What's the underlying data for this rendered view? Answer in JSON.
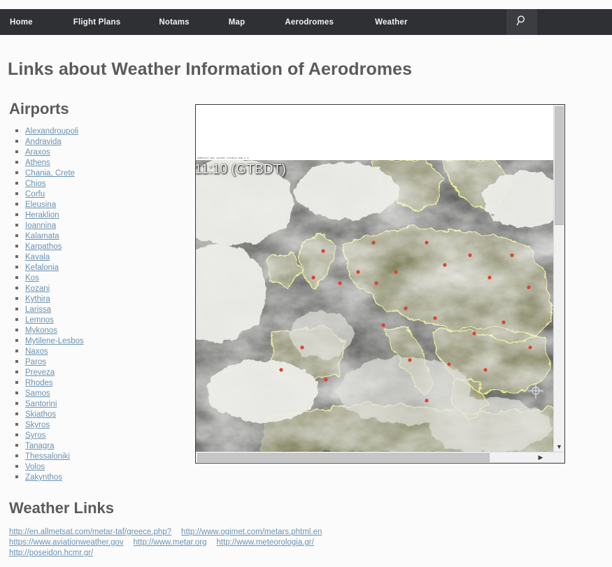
{
  "nav": {
    "items": [
      {
        "id": "home",
        "label": "Home"
      },
      {
        "id": "flight",
        "label": "Flight Plans"
      },
      {
        "id": "notams",
        "label": "Notams"
      },
      {
        "id": "map",
        "label": "Map"
      },
      {
        "id": "aerodromes",
        "label": "Aerodromes"
      },
      {
        "id": "weather",
        "label": "Weather"
      }
    ],
    "search_icon": "search-icon",
    "background_color": "#2f3033",
    "search_background_color": "#3c3d41",
    "text_color": "#f2f2f2"
  },
  "page": {
    "title": "Links about Weather Information of Aerodromes",
    "heading_color": "#5b5b5b",
    "background_color": "#fbfbfb",
    "link_color": "#6b93b3"
  },
  "airports": {
    "heading": "Airports",
    "items": [
      "Alexandroupoli",
      "Andravida",
      "Araxos",
      "Athens",
      "Chania, Crete",
      "Chios",
      "Corfu",
      "Eleusina",
      "Heraklion",
      "Ioannina",
      "Kalamata",
      "Karpathos",
      "Kavala",
      "Kefalonia",
      "Kos",
      "Kozani",
      "Kythira",
      "Larissa",
      "Lemnos",
      "Mykonos",
      "Mytilene-Lesbos",
      "Naxos",
      "Paros",
      "Preveza",
      "Rhodes",
      "Samos",
      "Santorini",
      "Skiathos",
      "Skyros",
      "Syros",
      "Tanagra",
      "Thessaloniki",
      "Volos",
      "Zakynthos"
    ]
  },
  "satellite": {
    "timestamp_overlay": "11:10 (GTBDT)",
    "micro_caption": "EUMETSAT MSG SEVIRI VISIBLE RGB 0.6",
    "scroll_down_arrow": "▼",
    "scroll_right_arrow": "▶",
    "coastline_color": "#e8e83c",
    "city_marker_color": "#e03a20",
    "land_color": "#5f6133",
    "sea_color": "#12130f",
    "cloud_color": "#f2f2ee"
  },
  "weather_links": {
    "heading": "Weather Links",
    "rows": [
      [
        "http://en.allmetsat.com/metar-taf/greece.php?",
        "http://www.ogimet.com/metars.phtml.en"
      ],
      [
        "https://www.aviationweather.gov",
        "http://www.metar.org",
        "http://www.meteorologia.gr/"
      ],
      [
        "http://poseidon.hcmr.gr/"
      ]
    ]
  }
}
